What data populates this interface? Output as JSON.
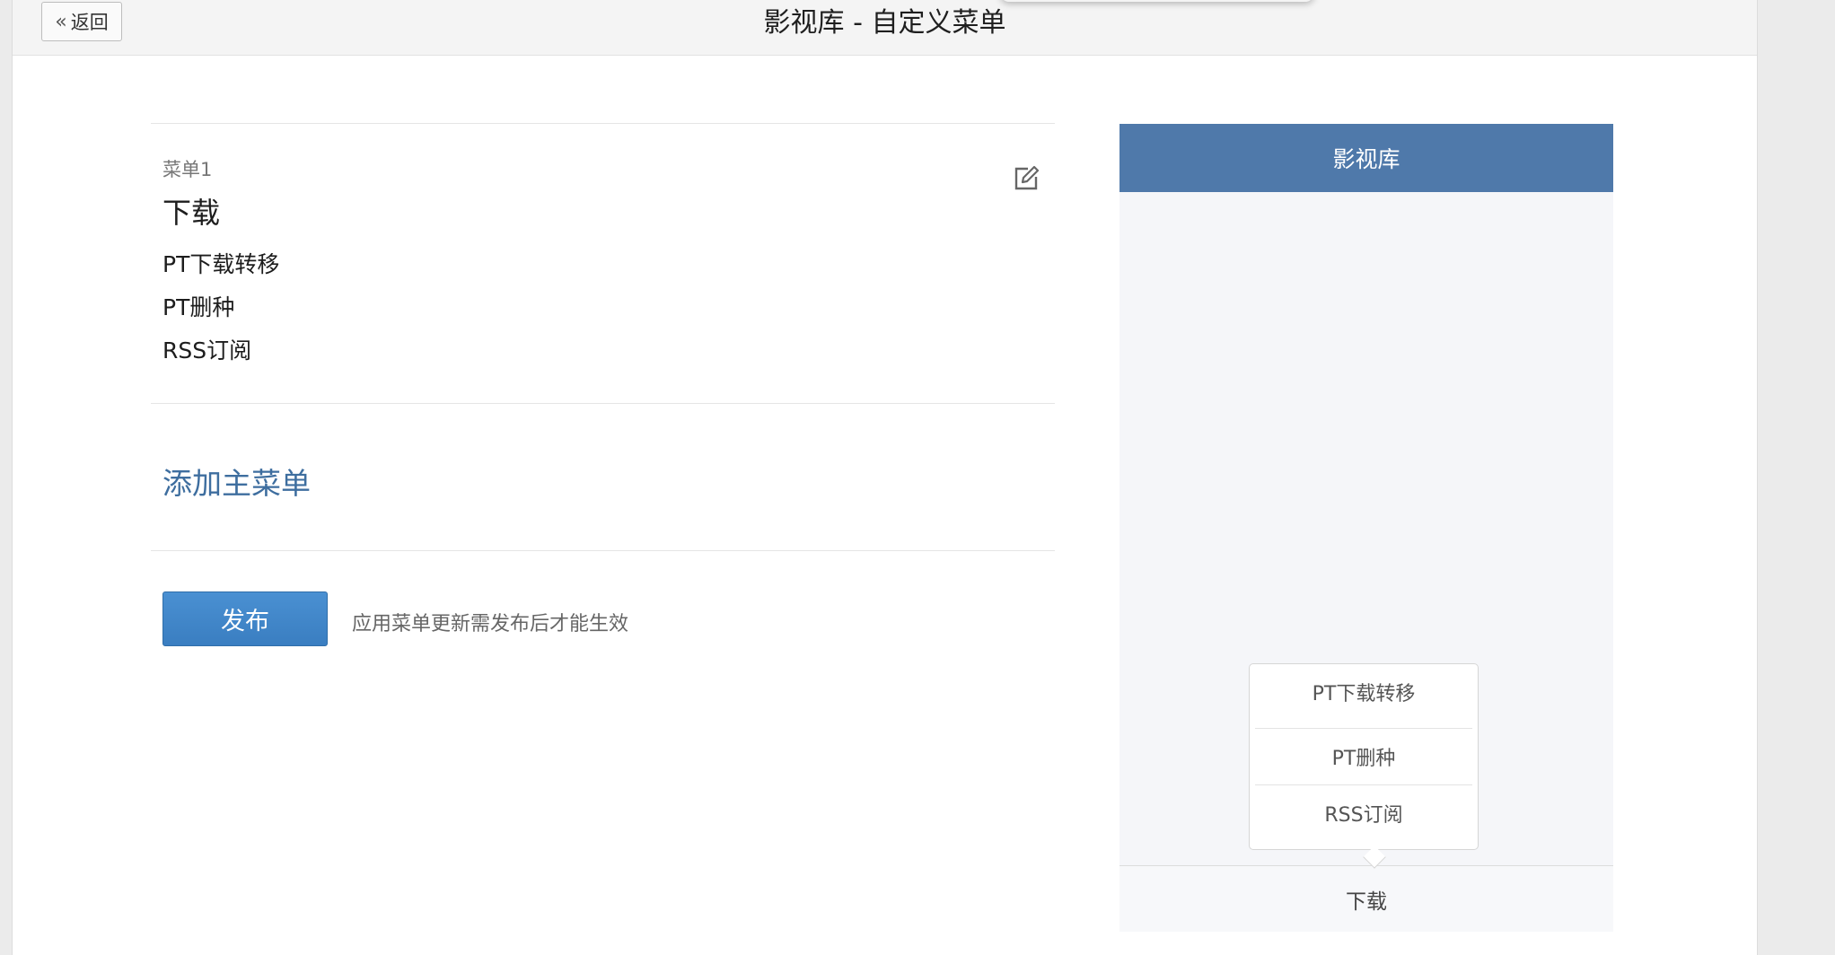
{
  "header": {
    "back_label": "返回",
    "title": "影视库 - 自定义菜单"
  },
  "editor": {
    "menu_caption": "菜单1",
    "menu_name": "下载",
    "sub_items": [
      "PT下载转移",
      "PT删种",
      "RSS订阅"
    ],
    "add_main_label": "添加主菜单",
    "publish_label": "发布",
    "publish_note": "应用菜单更新需发布后才能生效"
  },
  "preview": {
    "title": "影视库",
    "popup_items": [
      "PT下载转移",
      "PT删种",
      "RSS订阅"
    ],
    "footer_menu": "下载"
  },
  "icons": {
    "back": "double-chevron-left-icon",
    "edit": "edit-icon"
  },
  "colors": {
    "accent_link": "#3e6e9f",
    "publish_button": "#3a7ec1",
    "phone_header": "#4f79aa"
  }
}
